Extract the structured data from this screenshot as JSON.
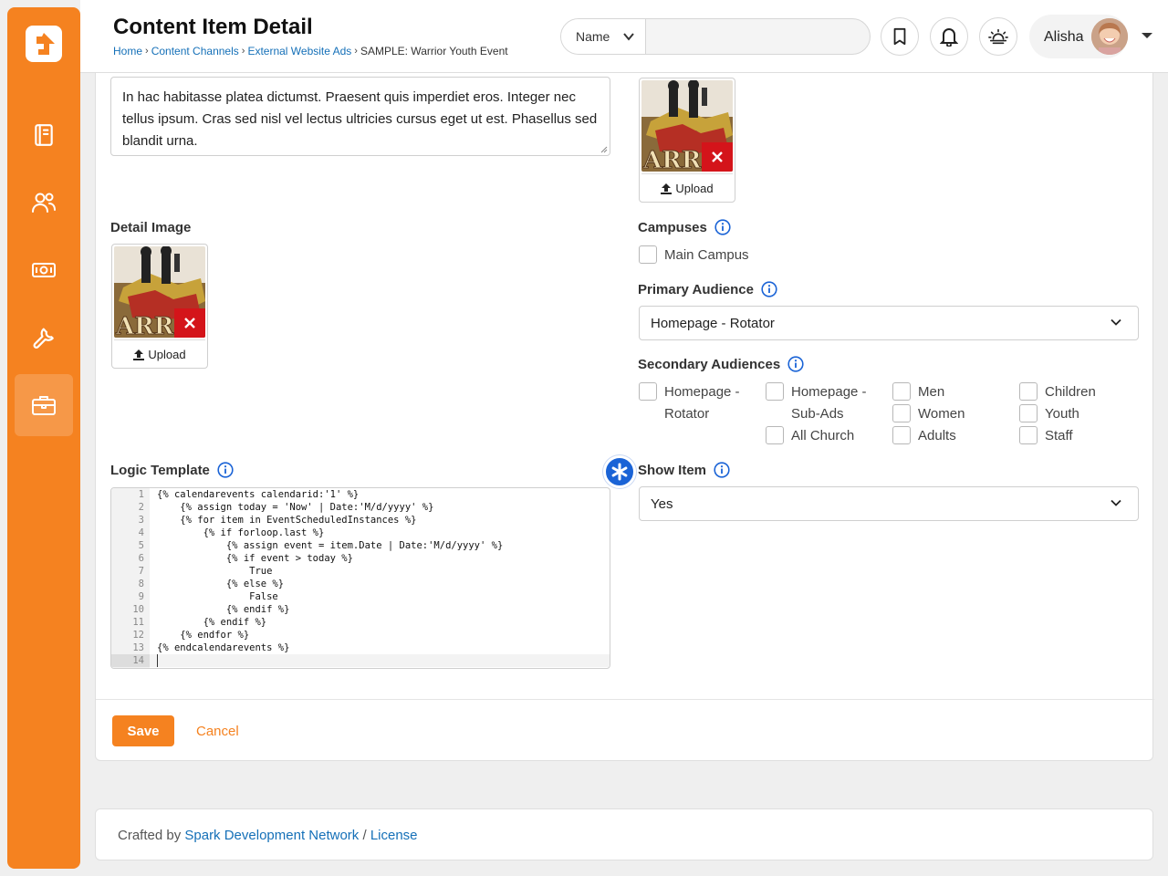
{
  "header": {
    "title": "Content Item Detail",
    "breadcrumb": [
      "Home",
      "Content Channels",
      "External Website Ads",
      "SAMPLE: Warrior Youth Event"
    ],
    "search_type": "Name",
    "search_value": "",
    "user_name": "Alisha",
    "icons": [
      "bookmark-icon",
      "bell-icon",
      "sun-horizon-icon",
      "chevron-down-icon"
    ]
  },
  "sidebar": {
    "items": [
      "logo-icon",
      "book-icon",
      "people-icon",
      "money-icon",
      "wrench-icon",
      "briefcase-icon"
    ],
    "active": "briefcase-icon"
  },
  "form": {
    "summary_text": "In hac habitasse platea dictumst. Praesent quis imperdiet eros. Integer nec tellus ipsum. Cras sed nisl vel lectus ultricies cursus eget ut est. Phasellus sed blandit urna.",
    "upload_label": "Upload",
    "detail_image_label": "Detail Image",
    "campuses_label": "Campuses",
    "campuses": [
      "Main Campus"
    ],
    "primary_audience_label": "Primary Audience",
    "primary_audience_value": "Homepage - Rotator",
    "secondary_audiences_label": "Secondary Audiences",
    "secondary_audiences": {
      "col1": [
        "Homepage - Rotator"
      ],
      "col2": [
        "Homepage - Sub-Ads",
        "All Church"
      ],
      "col3": [
        "Men",
        "Women",
        "Adults"
      ],
      "col4": [
        "Children",
        "Youth",
        "Staff"
      ]
    },
    "logic_template_label": "Logic Template",
    "logic_template_lines": [
      "{% calendarevents calendarid:'1' %}",
      "    {% assign today = 'Now' | Date:'M/d/yyyy' %}",
      "    {% for item in EventScheduledInstances %}",
      "        {% if forloop.last %}",
      "            {% assign event = item.Date | Date:'M/d/yyyy' %}",
      "            {% if event > today %}",
      "                True",
      "            {% else %}",
      "                False",
      "            {% endif %}",
      "        {% endif %}",
      "    {% endfor %}",
      "{% endcalendarevents %}",
      ""
    ],
    "line_numbers": [
      "1",
      "2",
      "3",
      "4",
      "5",
      "6",
      "7",
      "8",
      "9",
      "10",
      "11",
      "12",
      "13",
      "14"
    ],
    "show_item_label": "Show Item",
    "show_item_value": "Yes",
    "save_label": "Save",
    "cancel_label": "Cancel"
  },
  "footer": {
    "prefix": "Crafted by",
    "org_link": "Spark Development Network",
    "separator": "/",
    "license_link": "License"
  },
  "colors": {
    "brand_orange": "#f58220",
    "link_blue": "#1570b8",
    "remove_red": "#d4141a",
    "required_blue": "#1a63d6"
  }
}
